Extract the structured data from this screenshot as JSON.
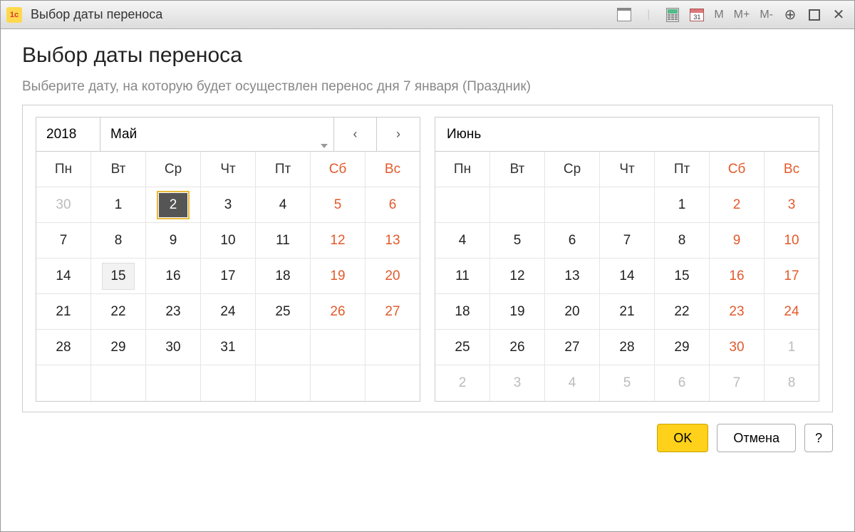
{
  "titlebar": {
    "title": "Выбор даты переноса",
    "buttons": {
      "M": "M",
      "Mplus": "M+",
      "Mminus": "M-"
    },
    "cal31": "31"
  },
  "page": {
    "heading": "Выбор даты переноса",
    "prompt": "Выберите дату, на которую будет осуществлен перенос дня 7 января (Праздник)"
  },
  "calendar1": {
    "year": "2018",
    "month": "Май",
    "nav_prev": "‹",
    "nav_next": "›",
    "dow": [
      "Пн",
      "Вт",
      "Ср",
      "Чт",
      "Пт",
      "Сб",
      "Вс"
    ],
    "weeks": [
      [
        {
          "d": "30",
          "muted": true
        },
        {
          "d": "1"
        },
        {
          "d": "2",
          "selected": true
        },
        {
          "d": "3"
        },
        {
          "d": "4"
        },
        {
          "d": "5",
          "weekend": true
        },
        {
          "d": "6",
          "weekend": true
        }
      ],
      [
        {
          "d": "7"
        },
        {
          "d": "8"
        },
        {
          "d": "9"
        },
        {
          "d": "10"
        },
        {
          "d": "11"
        },
        {
          "d": "12",
          "weekend": true
        },
        {
          "d": "13",
          "weekend": true
        }
      ],
      [
        {
          "d": "14"
        },
        {
          "d": "15",
          "hover": true
        },
        {
          "d": "16"
        },
        {
          "d": "17"
        },
        {
          "d": "18"
        },
        {
          "d": "19",
          "weekend": true
        },
        {
          "d": "20",
          "weekend": true
        }
      ],
      [
        {
          "d": "21"
        },
        {
          "d": "22"
        },
        {
          "d": "23"
        },
        {
          "d": "24"
        },
        {
          "d": "25"
        },
        {
          "d": "26",
          "weekend": true
        },
        {
          "d": "27",
          "weekend": true
        }
      ],
      [
        {
          "d": "28"
        },
        {
          "d": "29"
        },
        {
          "d": "30"
        },
        {
          "d": "31"
        },
        {
          "d": ""
        },
        {
          "d": ""
        },
        {
          "d": ""
        }
      ],
      [
        {
          "d": ""
        },
        {
          "d": ""
        },
        {
          "d": ""
        },
        {
          "d": ""
        },
        {
          "d": ""
        },
        {
          "d": ""
        },
        {
          "d": ""
        }
      ]
    ]
  },
  "calendar2": {
    "month": "Июнь",
    "dow": [
      "Пн",
      "Вт",
      "Ср",
      "Чт",
      "Пт",
      "Сб",
      "Вс"
    ],
    "weeks": [
      [
        {
          "d": ""
        },
        {
          "d": ""
        },
        {
          "d": ""
        },
        {
          "d": ""
        },
        {
          "d": "1"
        },
        {
          "d": "2",
          "weekend": true
        },
        {
          "d": "3",
          "weekend": true
        }
      ],
      [
        {
          "d": "4"
        },
        {
          "d": "5"
        },
        {
          "d": "6"
        },
        {
          "d": "7"
        },
        {
          "d": "8"
        },
        {
          "d": "9",
          "weekend": true
        },
        {
          "d": "10",
          "weekend": true
        }
      ],
      [
        {
          "d": "11"
        },
        {
          "d": "12"
        },
        {
          "d": "13"
        },
        {
          "d": "14"
        },
        {
          "d": "15"
        },
        {
          "d": "16",
          "weekend": true
        },
        {
          "d": "17",
          "weekend": true
        }
      ],
      [
        {
          "d": "18"
        },
        {
          "d": "19"
        },
        {
          "d": "20"
        },
        {
          "d": "21"
        },
        {
          "d": "22"
        },
        {
          "d": "23",
          "weekend": true
        },
        {
          "d": "24",
          "weekend": true
        }
      ],
      [
        {
          "d": "25"
        },
        {
          "d": "26"
        },
        {
          "d": "27"
        },
        {
          "d": "28"
        },
        {
          "d": "29"
        },
        {
          "d": "30",
          "weekend": true
        },
        {
          "d": "1",
          "muted": true
        }
      ],
      [
        {
          "d": "2",
          "muted": true
        },
        {
          "d": "3",
          "muted": true
        },
        {
          "d": "4",
          "muted": true
        },
        {
          "d": "5",
          "muted": true
        },
        {
          "d": "6",
          "muted": true
        },
        {
          "d": "7",
          "muted": true
        },
        {
          "d": "8",
          "muted": true
        }
      ]
    ]
  },
  "buttons": {
    "ok": "OK",
    "cancel": "Отмена",
    "help": "?"
  }
}
